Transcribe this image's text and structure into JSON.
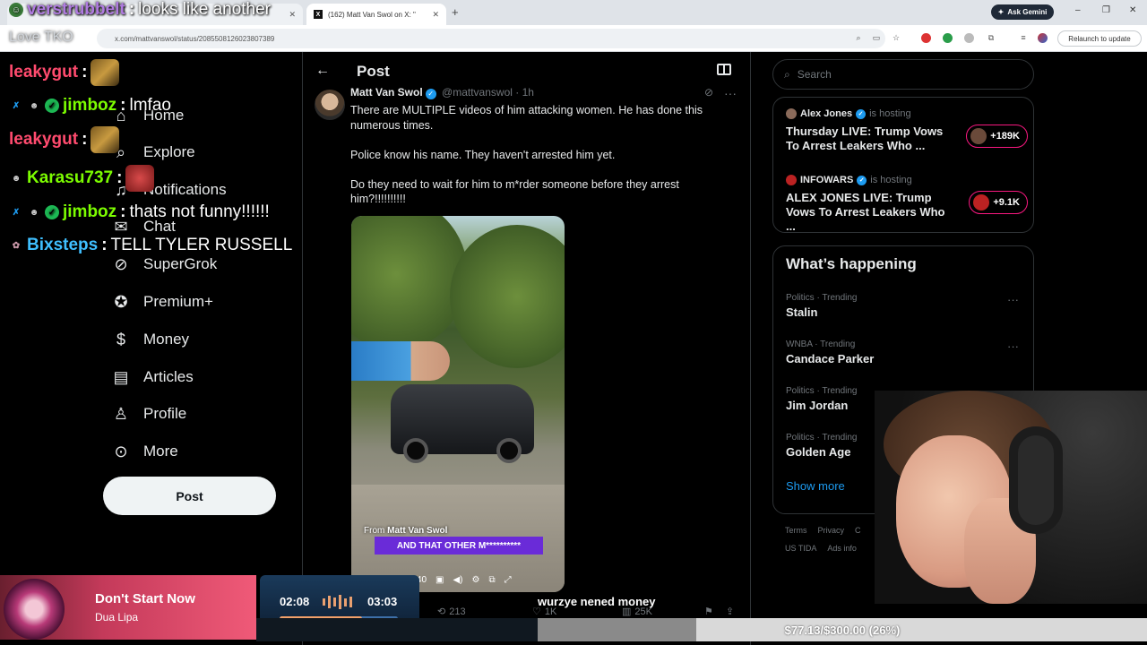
{
  "browser": {
    "tabs": [
      {
        "label": "",
        "favicon": ""
      },
      {
        "label": "(162) Matt Van Swol on X: \"",
        "favicon": "X"
      }
    ],
    "url": "x.com/mattvanswol/status/2085508126023807389",
    "gemini_label": "Ask Gemini",
    "relaunch_label": "Relaunch to update"
  },
  "chat": {
    "overlay_label": "Love TKO",
    "messages": [
      {
        "user": "verstrubbelt",
        "text": "looks like another",
        "color": "#b07be0"
      },
      {
        "user": "leakygut",
        "text": "",
        "color": "#ff4b6e",
        "emote": true
      },
      {
        "user": "jimboz",
        "text": "lmfao",
        "color": "#7cfc00"
      },
      {
        "user": "leakygut",
        "text": "",
        "color": "#ff4b6e",
        "emote": true
      },
      {
        "user": "Karasu737",
        "text": "",
        "color": "#7cfc00",
        "emote": true
      },
      {
        "user": "jimboz",
        "text": "thats not funny!!!!!!",
        "color": "#7cfc00"
      },
      {
        "user": "Bixsteps",
        "text": "TELL TYLER RUSSELL",
        "color": "#3fbfff"
      }
    ]
  },
  "nav": {
    "items": [
      {
        "label": "Home",
        "icon": "home-icon"
      },
      {
        "label": "Explore",
        "icon": "search-icon"
      },
      {
        "label": "Notifications",
        "icon": "bell-icon"
      },
      {
        "label": "Chat",
        "icon": "chat-icon"
      },
      {
        "label": "SuperGrok",
        "icon": "grok-icon"
      },
      {
        "label": "Premium+",
        "icon": "verified-icon"
      },
      {
        "label": "Money",
        "icon": "money-icon"
      },
      {
        "label": "Articles",
        "icon": "article-icon"
      },
      {
        "label": "Profile",
        "icon": "person-icon"
      },
      {
        "label": "More",
        "icon": "more-circle-icon"
      }
    ],
    "post_button": "Post"
  },
  "post": {
    "header_title": "Post",
    "author_name": "Matt Van Swol",
    "author_handle": "@mattvanswol",
    "time": "· 1h",
    "text": "There are MULTIPLE videos of him attacking women.  He has done this numerous times.\n\nPolice know his name.  They haven't arrested him yet.\n\nDo they need to wait for him to m*rder someone before they arrest him?!!!!!!!!!!",
    "video": {
      "from_label": "From",
      "from_name": "Matt Van Swol",
      "caption": "AND THAT OTHER M**********",
      "time": "0:01 / 0:40"
    },
    "actions": {
      "retweets": "213",
      "likes": "1K",
      "views": "25K"
    }
  },
  "overlay_text": "wurzye nened money",
  "sidebar": {
    "search_placeholder": "Search",
    "spaces": [
      {
        "host": "Alex Jones",
        "status": "is hosting",
        "title": "Thursday LIVE: Trump Vows To Arrest Leakers Who ...",
        "listeners": "+189K"
      },
      {
        "host": "INFOWARS",
        "status": "is hosting",
        "title": "ALEX JONES LIVE: Trump Vows To Arrest Leakers Who ...",
        "listeners": "+9.1K"
      }
    ],
    "happening_title": "What’s happening",
    "trends": [
      {
        "context": "Politics · Trending",
        "title": "Stalin"
      },
      {
        "context": "WNBA · Trending",
        "title": "Candace Parker"
      },
      {
        "context": "Politics · Trending",
        "title": "Jim Jordan"
      },
      {
        "context": "Politics · Trending",
        "title": "Golden Age"
      }
    ],
    "show_more": "Show more",
    "footer": [
      "Terms",
      "Privacy",
      "C",
      "US TIDA",
      "Ads info"
    ]
  },
  "now_playing": {
    "title": "Don't Start Now",
    "artist": "Dua Lipa",
    "current": "02:08",
    "total": "03:03",
    "progress": 0.7
  },
  "goal": {
    "text": "$77.13/$300.00 (26%)",
    "progress": 0.26
  }
}
